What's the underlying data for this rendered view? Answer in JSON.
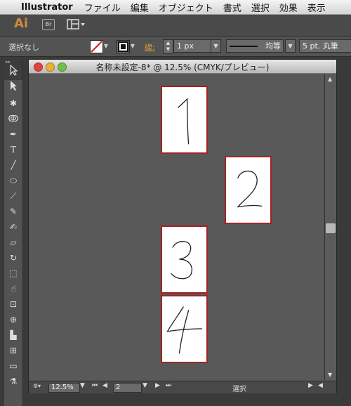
{
  "menubar": {
    "apple_icon": "apple-icon",
    "app_name": "Illustrator",
    "menus": [
      "ファイル",
      "編集",
      "オブジェクト",
      "書式",
      "選択",
      "効果",
      "表示"
    ]
  },
  "appbar": {
    "logo": "Ai",
    "bridge_label": "Br"
  },
  "control_bar": {
    "selection_label": "選択なし",
    "stroke_label": "線:",
    "stroke_weight": "1 px",
    "profile_label": "均等",
    "brush_label": "5 pt. 丸筆"
  },
  "tools_panel": {
    "collapse_label": "▸▸",
    "tools": [
      "selection-tool",
      "direct-selection-tool",
      "magic-wand-tool",
      "lasso-tool",
      "pen-tool",
      "type-tool",
      "line-tool",
      "ellipse-tool",
      "paintbrush-tool",
      "pencil-tool",
      "blob-brush-tool",
      "eraser-tool",
      "rotate-tool",
      "scale-tool",
      "warp-tool",
      "free-transform-tool",
      "shape-builder-tool",
      "graph-tool",
      "mesh-tool",
      "gradient-tool",
      "eyedropper-tool"
    ]
  },
  "document": {
    "title": "名称未設定-8* @ 12.5% (CMYK/プレビュー)",
    "zoom": "12.5%",
    "page": "2",
    "status": "選択",
    "artboards": [
      {
        "label": "1"
      },
      {
        "label": "2"
      },
      {
        "label": "3"
      },
      {
        "label": "4"
      }
    ]
  },
  "colors": {
    "artboard_border": "#a02424",
    "canvas": "#595959",
    "accent_orange": "#d08a3c"
  }
}
